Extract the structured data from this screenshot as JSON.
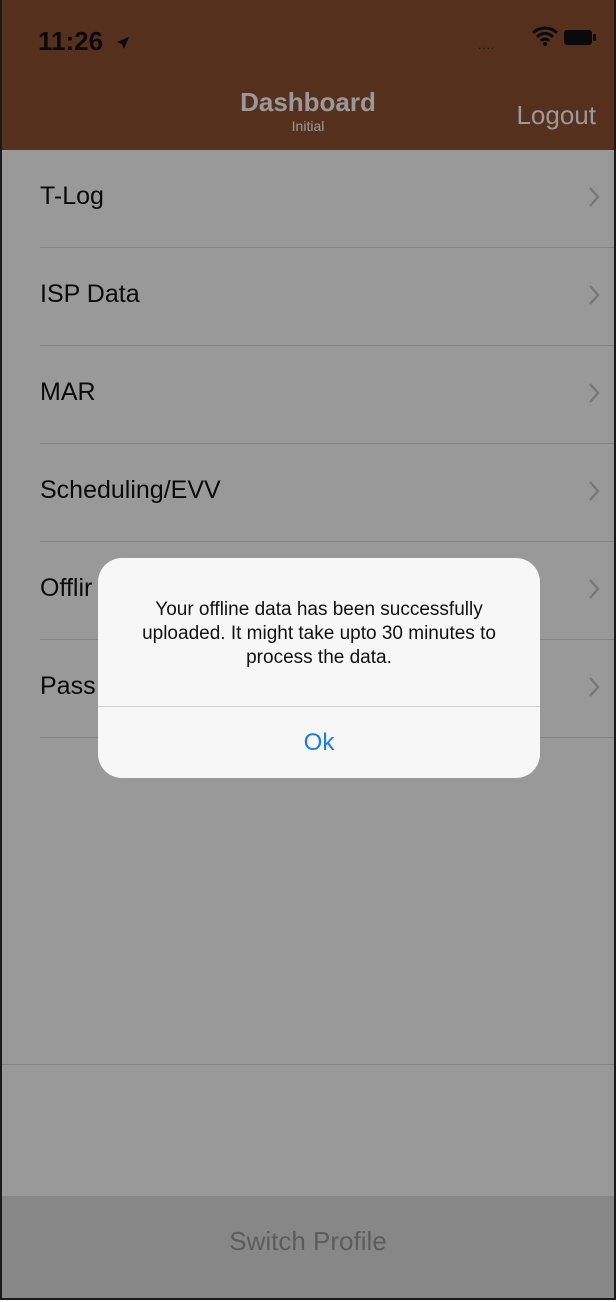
{
  "colors": {
    "header_bg": "#8e5231",
    "header_text": "#ffffff",
    "link_blue": "#1a7cf5"
  },
  "status_bar": {
    "time": "11:26",
    "signal": "....",
    "icons": [
      "location-arrow-icon",
      "wifi-icon",
      "battery-icon"
    ]
  },
  "nav_bar": {
    "title": "Dashboard",
    "subtitle": "Initial",
    "logout_label": "Logout"
  },
  "menu": {
    "items": [
      {
        "label": "T-Log"
      },
      {
        "label": "ISP Data"
      },
      {
        "label": "MAR"
      },
      {
        "label": "Scheduling/EVV"
      },
      {
        "label": "Offlir"
      },
      {
        "label": "Pass"
      }
    ]
  },
  "footer": {
    "switch_profile_label": "Switch Profile"
  },
  "alert": {
    "message": "Your offline data has been successfully uploaded. It might take upto 30 minutes to process the data.",
    "ok_label": "Ok"
  }
}
